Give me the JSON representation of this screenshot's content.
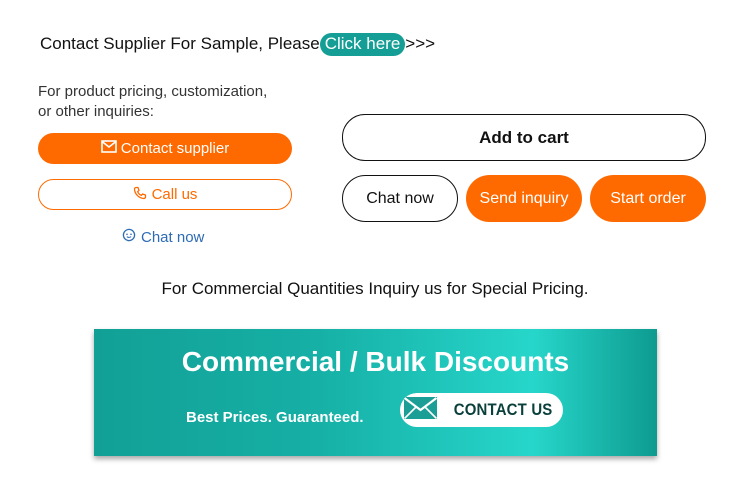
{
  "sample": {
    "prefix": "Contact Supplier For Sample, Please",
    "link_label": "Click here",
    "suffix": ">>>"
  },
  "inquiry_panel": {
    "intro_line1": "For product pricing, customization,",
    "intro_line2": "or other inquiries:",
    "contact_supplier_label": "Contact supplier",
    "call_us_label": "Call us",
    "chat_now_label": "Chat now"
  },
  "actions": {
    "add_to_cart_label": "Add to cart",
    "chat_now_label": "Chat now",
    "send_inquiry_label": "Send inquiry",
    "start_order_label": "Start order"
  },
  "commercial_note": "For Commercial Quantities Inquiry us for Special Pricing.",
  "banner": {
    "title": "Commercial / Bulk Discounts",
    "subtitle": "Best Prices. Guaranteed.",
    "contact_label": "CONTACT US"
  },
  "colors": {
    "accent_orange": "#ff6a00",
    "teal": "#159e95",
    "chat_blue": "#2d6bb5"
  },
  "icons": [
    "envelope-icon",
    "phone-icon",
    "chat-bubble-icon",
    "mail-icon"
  ]
}
